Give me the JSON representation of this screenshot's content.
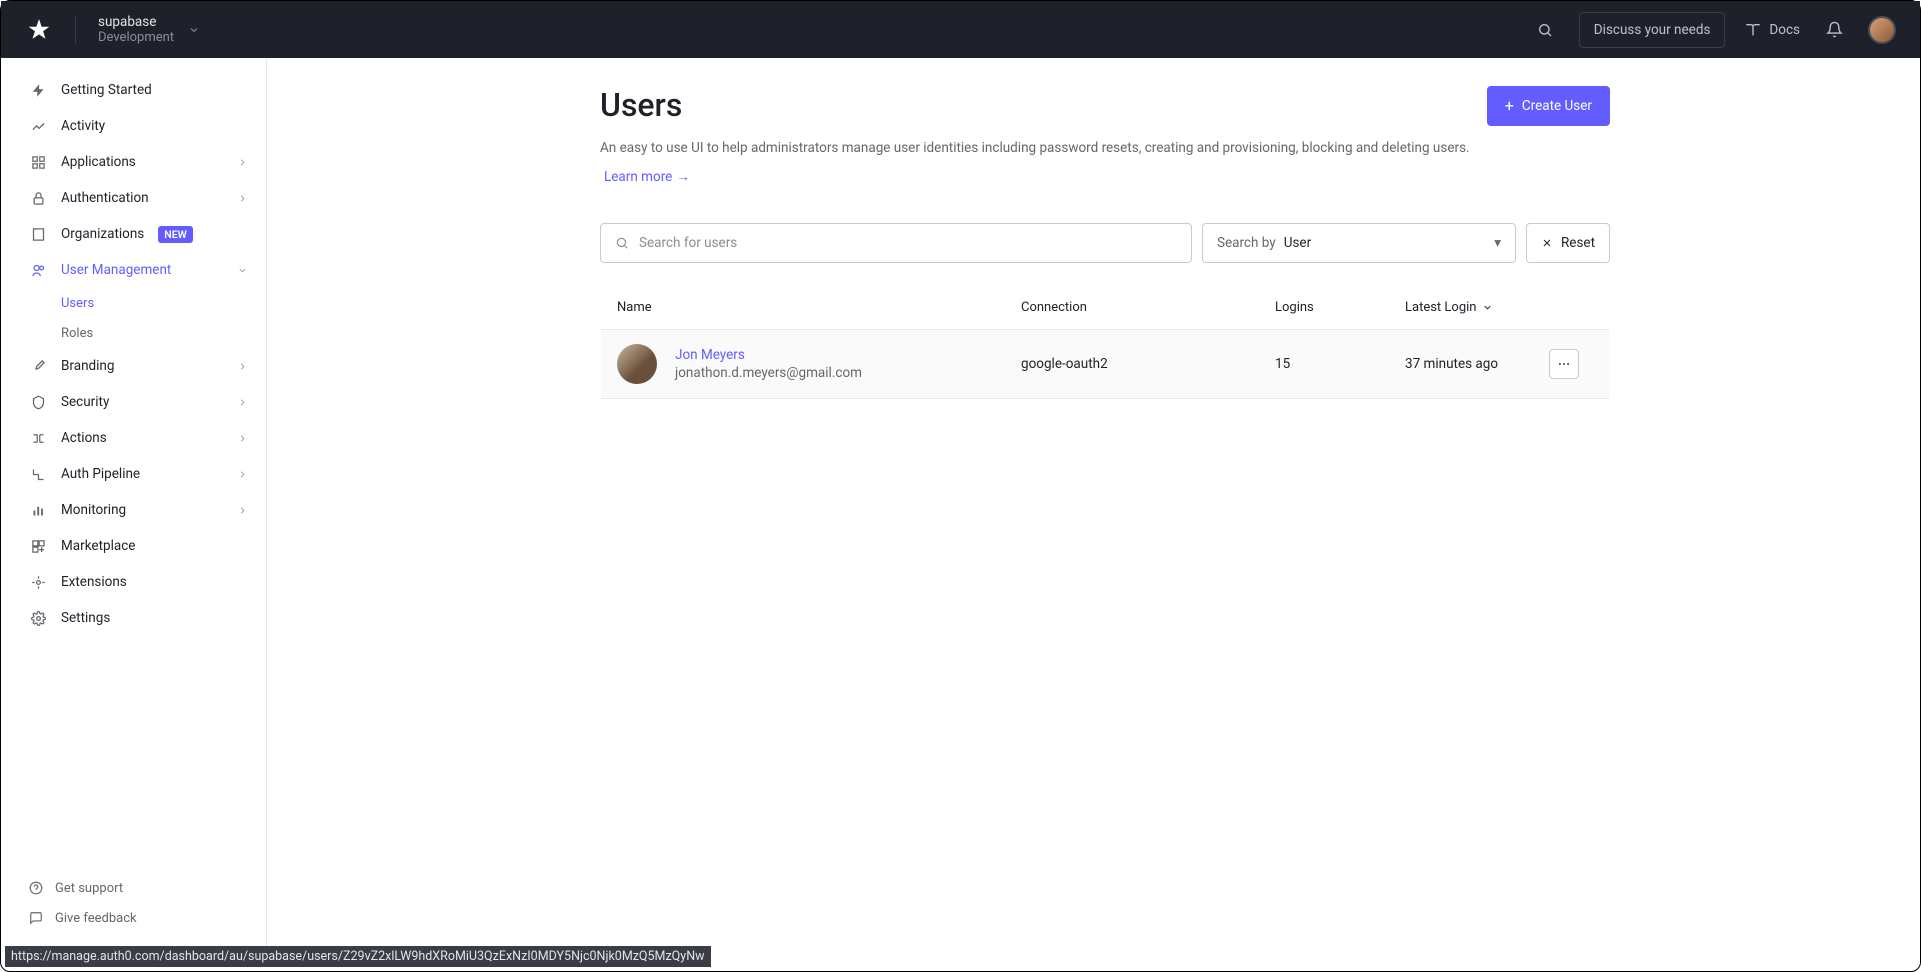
{
  "header": {
    "tenant_name": "supabase",
    "tenant_env": "Development",
    "discuss_label": "Discuss your needs",
    "docs_label": "Docs"
  },
  "sidebar": {
    "items": [
      {
        "label": "Getting Started",
        "icon": "bolt"
      },
      {
        "label": "Activity",
        "icon": "chart"
      },
      {
        "label": "Applications",
        "icon": "grid",
        "expandable": true
      },
      {
        "label": "Authentication",
        "icon": "lock",
        "expandable": true
      },
      {
        "label": "Organizations",
        "icon": "building",
        "badge": "NEW"
      },
      {
        "label": "User Management",
        "icon": "user",
        "expandable": true,
        "active": true
      },
      {
        "label": "Branding",
        "icon": "brush",
        "expandable": true
      },
      {
        "label": "Security",
        "icon": "shield",
        "expandable": true
      },
      {
        "label": "Actions",
        "icon": "flow",
        "expandable": true
      },
      {
        "label": "Auth Pipeline",
        "icon": "pipe",
        "expandable": true
      },
      {
        "label": "Monitoring",
        "icon": "bars",
        "expandable": true
      },
      {
        "label": "Marketplace",
        "icon": "square"
      },
      {
        "label": "Extensions",
        "icon": "puzzle"
      },
      {
        "label": "Settings",
        "icon": "gear"
      }
    ],
    "sub_users": "Users",
    "sub_roles": "Roles",
    "support": "Get support",
    "feedback": "Give feedback"
  },
  "page": {
    "title": "Users",
    "description": "An easy to use UI to help administrators manage user identities including password resets, creating and provisioning, blocking and deleting users.",
    "learn_more": "Learn more",
    "create_label": "Create User",
    "search_placeholder": "Search for users",
    "searchby_label": "Search by",
    "searchby_value": "User",
    "reset_label": "Reset"
  },
  "table": {
    "columns": [
      "Name",
      "Connection",
      "Logins",
      "Latest Login"
    ],
    "rows": [
      {
        "name": "Jon Meyers",
        "email": "jonathon.d.meyers@gmail.com",
        "connection": "google-oauth2",
        "logins": "15",
        "latest": "37 minutes ago"
      }
    ]
  },
  "status_url": "https://manage.auth0.com/dashboard/au/supabase/users/Z29vZ2xlLW9hdXRoMiU3QzExNzI0MDY5Njc0Njk0MzQ5MzQyNw"
}
